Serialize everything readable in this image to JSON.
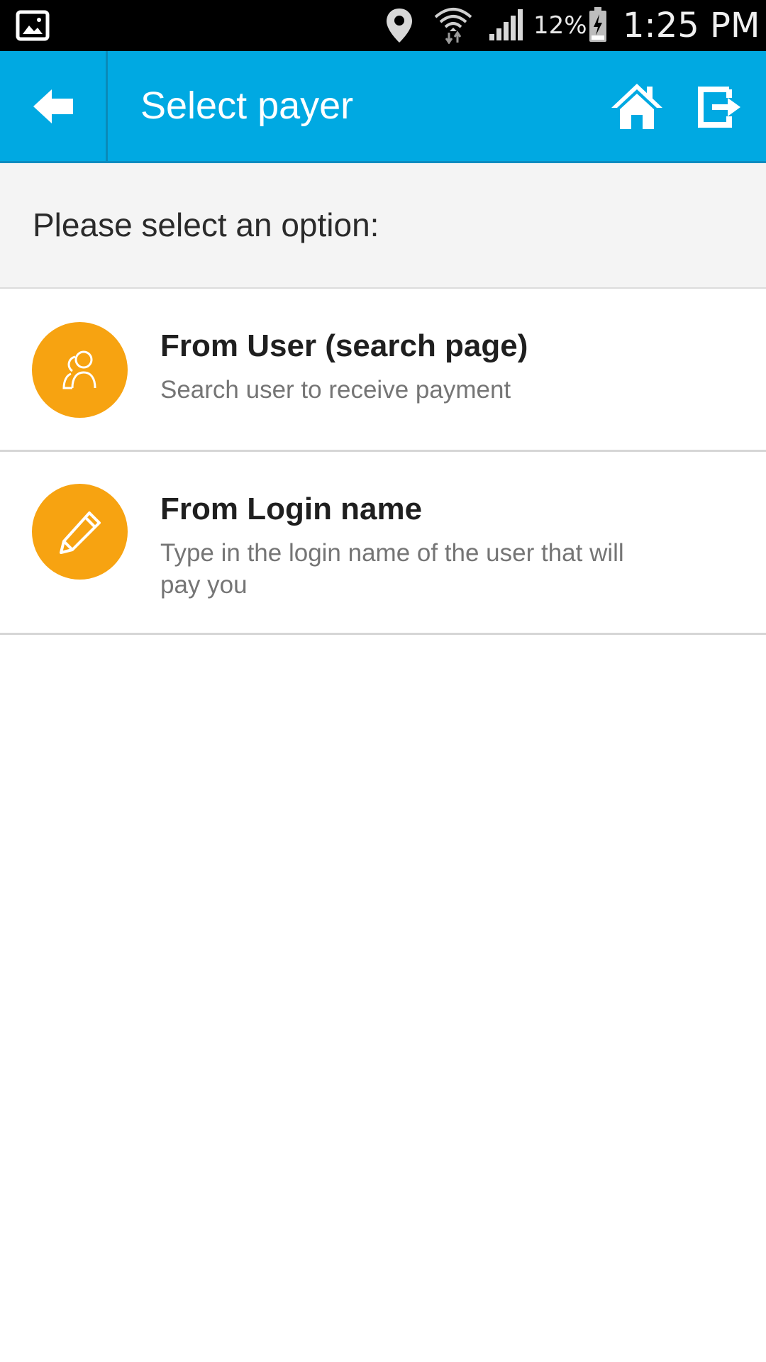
{
  "status_bar": {
    "battery_percent": "12%",
    "time": "1:25 PM",
    "icons": [
      "gallery-icon",
      "location-icon",
      "wifi-icon",
      "signal-icon",
      "battery-charging-icon"
    ]
  },
  "app_bar": {
    "title": "Select payer",
    "back_icon": "arrow-left-icon",
    "home_icon": "home-icon",
    "logout_icon": "logout-icon",
    "background_color": "#00a9e2"
  },
  "prompt": {
    "text": "Please select an option:"
  },
  "options": [
    {
      "title": "From User (search page)",
      "description": "Search user to receive payment",
      "icon": "users-icon",
      "icon_color": "#f7a311"
    },
    {
      "title": "From Login name",
      "description": "Type in the login name of the user that will pay you",
      "icon": "pencil-icon",
      "icon_color": "#f7a311"
    }
  ]
}
